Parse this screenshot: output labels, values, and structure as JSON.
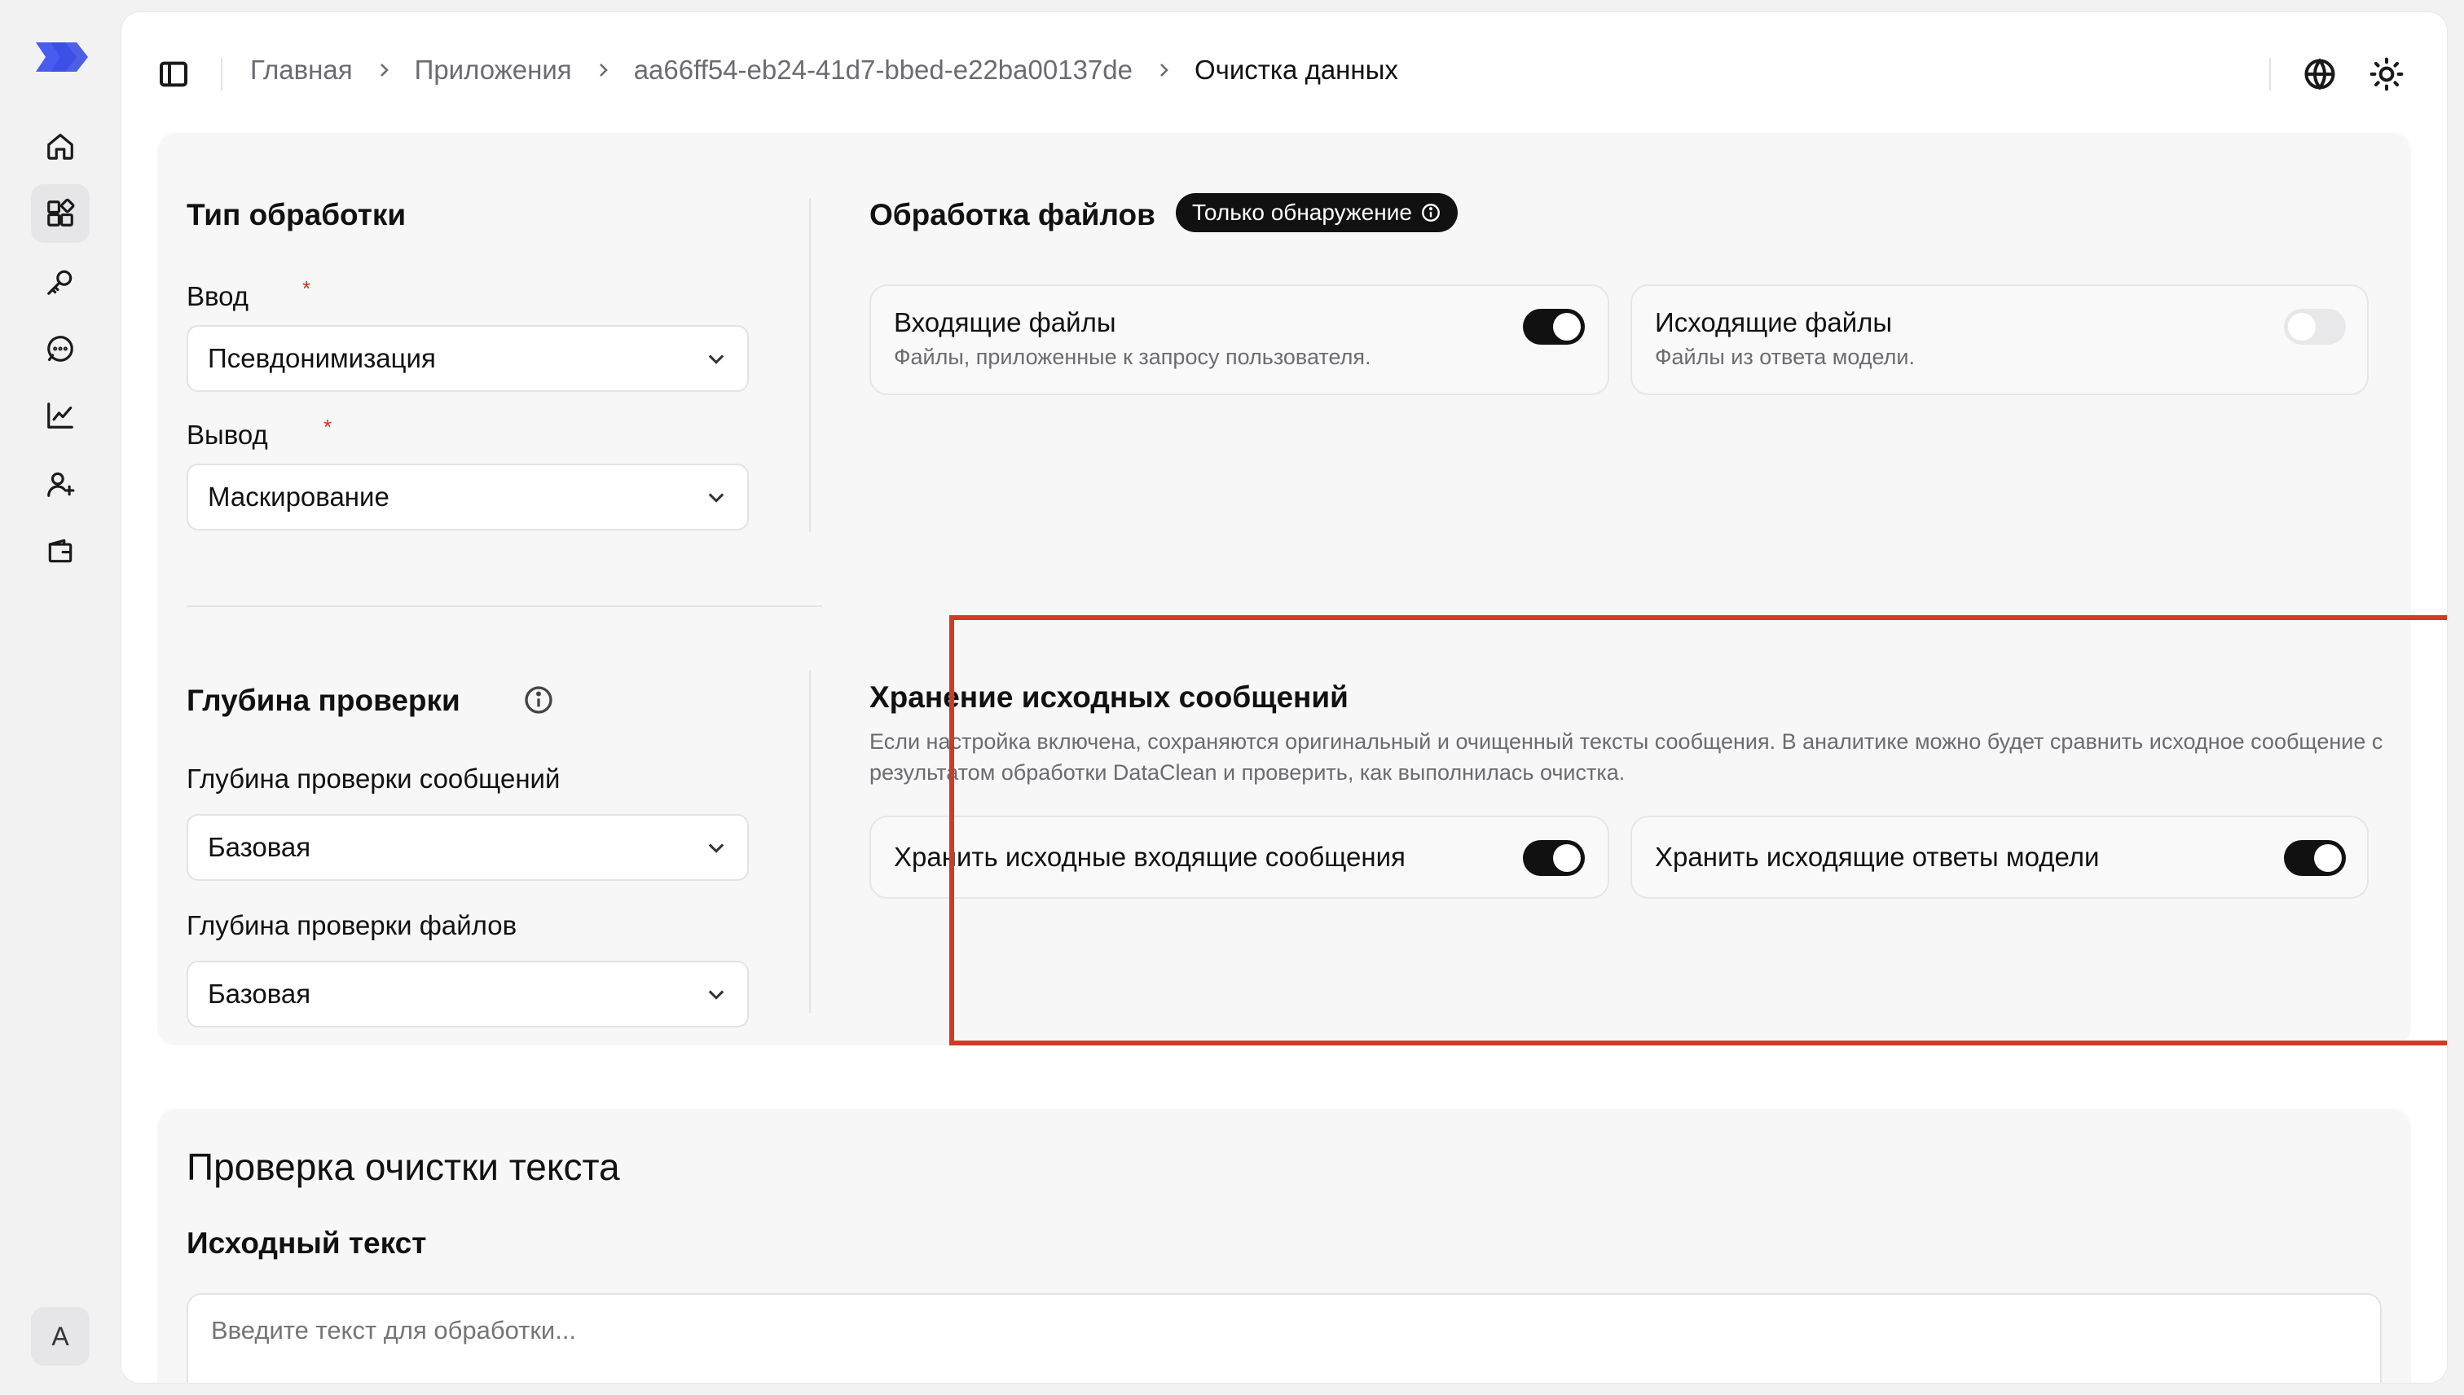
{
  "sidebar": {
    "items": [
      {
        "name": "home",
        "icon": "home-icon",
        "active": false
      },
      {
        "name": "apps",
        "icon": "apps-icon",
        "active": true
      },
      {
        "name": "keys",
        "icon": "key-icon",
        "active": false
      },
      {
        "name": "chat",
        "icon": "chat-icon",
        "active": false
      },
      {
        "name": "analytics",
        "icon": "chart-icon",
        "active": false
      },
      {
        "name": "add-user",
        "icon": "user-plus-icon",
        "active": false
      },
      {
        "name": "wallet",
        "icon": "wallet-icon",
        "active": false
      }
    ],
    "avatar_letter": "A"
  },
  "breadcrumb": {
    "home": "Главная",
    "apps": "Приложения",
    "app_id": "aa66ff54-eb24-41d7-bbed-e22ba00137de",
    "current": "Очистка данных"
  },
  "processing_type": {
    "title": "Тип обработки",
    "input_label": "Ввод",
    "input_value": "Псевдонимизация",
    "output_label": "Вывод",
    "output_value": "Маскирование",
    "required_mark": "*"
  },
  "file_processing": {
    "title": "Обработка файлов",
    "badge": "Только обнаружение",
    "incoming": {
      "title": "Входящие файлы",
      "subtitle": "Файлы, приложенные к запросу пользователя.",
      "enabled": true
    },
    "outgoing": {
      "title": "Исходящие файлы",
      "subtitle": "Файлы из ответа модели.",
      "enabled": false
    }
  },
  "check_depth": {
    "title": "Глубина проверки",
    "messages_label": "Глубина проверки сообщений",
    "messages_value": "Базовая",
    "files_label": "Глубина проверки файлов",
    "files_value": "Базовая"
  },
  "storage": {
    "title": "Хранение исходных сообщений",
    "description": "Если настройка включена, сохраняются оригинальный и очищенный тексты сообщения. В аналитике можно будет сравнить исходное сообщение с результатом обработки DataClean и проверить, как выполнилась очистка.",
    "store_incoming": {
      "label": "Хранить исходные входящие сообщения",
      "enabled": true
    },
    "store_outgoing": {
      "label": "Хранить исходящие ответы модели",
      "enabled": true
    },
    "highlight_color": "#d23a22"
  },
  "text_check": {
    "title": "Проверка очистки текста",
    "source_label": "Исходный текст",
    "placeholder": "Введите текст для обработки..."
  },
  "colors": {
    "accent": "#4a5cf0",
    "toggle_on": "#111111",
    "toggle_off": "#e8e8ea"
  }
}
